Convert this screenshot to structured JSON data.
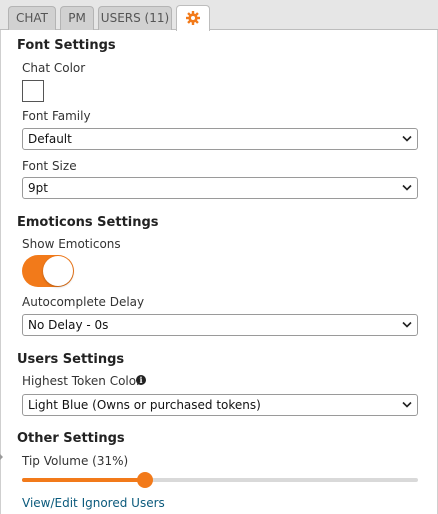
{
  "tabs": {
    "chat": "CHAT",
    "pm": "PM",
    "users": "USERS (11)",
    "settings_icon": "gear-icon"
  },
  "font_settings": {
    "title": "Font Settings",
    "chat_color_label": "Chat Color",
    "chat_color_value": "#ffffff",
    "font_family_label": "Font Family",
    "font_family_value": "Default",
    "font_size_label": "Font Size",
    "font_size_value": "9pt"
  },
  "emoticons_settings": {
    "title": "Emoticons Settings",
    "show_emoticons_label": "Show Emoticons",
    "show_emoticons_on": true,
    "autocomplete_delay_label": "Autocomplete Delay",
    "autocomplete_delay_value": "No Delay - 0s"
  },
  "users_settings": {
    "title": "Users Settings",
    "highest_token_color_label": "Highest Token Color",
    "highest_token_color_value": "Light Blue (Owns or purchased tokens)",
    "info_icon": "info-icon"
  },
  "other_settings": {
    "title": "Other Settings",
    "tip_volume_label": "Tip Volume (31%)",
    "tip_volume_fraction": 0.31,
    "ignored_users_link": "View/Edit Ignored Users"
  },
  "colors": {
    "accent": "#f27a1a",
    "link": "#0b5a7c",
    "tab_bg": "#d1d1d1"
  }
}
